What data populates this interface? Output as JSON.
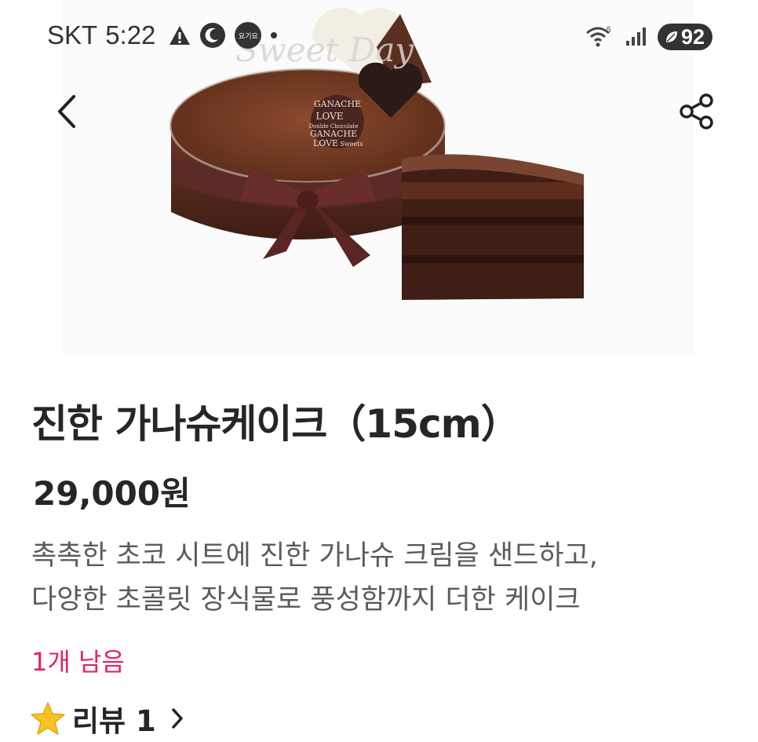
{
  "status_bar": {
    "carrier": "SKT",
    "time": "5:22",
    "notification_badge": "요기요",
    "battery": "92",
    "network": "5"
  },
  "hero_image": {
    "topper_text": "Sweet Day",
    "chocolate_disc_text": [
      "GANACHE",
      "LOVE",
      "Double Chocolate",
      "GANACHE",
      "LOVE",
      "Sweets"
    ]
  },
  "product": {
    "title": "진한 가나슈케이크（15cm）",
    "price": "29,000원",
    "description_lines": [
      "촉촉한 초코 시트에 진한 가나슈 크림을 샌드하고,",
      "다양한 초콜릿 장식물로 풍성함까지 더한 케이크"
    ],
    "stock": "1개 남음",
    "review_label": "리뷰 1"
  },
  "colors": {
    "accent_stock": "#e0245e",
    "star": "#f7c325",
    "text_primary": "#262626",
    "text_secondary": "#5b5b5b"
  },
  "icons": {
    "back": "chevron-left-icon",
    "share": "share-icon",
    "review": "star-icon",
    "review_more": "chevron-right-icon"
  }
}
